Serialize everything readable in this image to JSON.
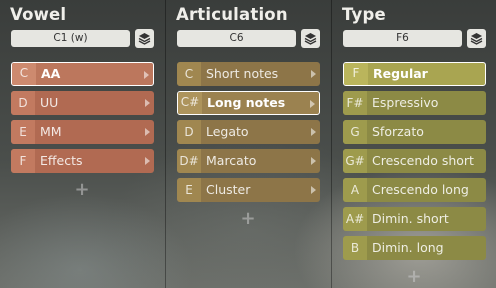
{
  "columns": [
    {
      "title": "Vowel",
      "selector": "C1 (w)",
      "theme": "red",
      "rows": [
        {
          "note": "C",
          "label": "AA",
          "active": true,
          "arrow": true
        },
        {
          "note": "D",
          "label": "UU",
          "active": false,
          "arrow": true
        },
        {
          "note": "E",
          "label": "MM",
          "active": false,
          "arrow": true
        },
        {
          "note": "F",
          "label": "Effects",
          "active": false,
          "arrow": true
        }
      ],
      "add_label": "+"
    },
    {
      "title": "Articulation",
      "selector": "C6",
      "theme": "tan",
      "rows": [
        {
          "note": "C",
          "label": "Short notes",
          "active": false,
          "arrow": true
        },
        {
          "note": "C#",
          "label": "Long notes",
          "active": true,
          "arrow": true
        },
        {
          "note": "D",
          "label": "Legato",
          "active": false,
          "arrow": true
        },
        {
          "note": "D#",
          "label": "Marcato",
          "active": false,
          "arrow": true
        },
        {
          "note": "E",
          "label": "Cluster",
          "active": false,
          "arrow": true
        }
      ],
      "add_label": "+"
    },
    {
      "title": "Type",
      "selector": "F6",
      "theme": "olive",
      "rows": [
        {
          "note": "F",
          "label": "Regular",
          "active": true,
          "arrow": false
        },
        {
          "note": "F#",
          "label": "Espressivo",
          "active": false,
          "arrow": false
        },
        {
          "note": "G",
          "label": "Sforzato",
          "active": false,
          "arrow": false
        },
        {
          "note": "G#",
          "label": "Crescendo short",
          "active": false,
          "arrow": false
        },
        {
          "note": "A",
          "label": "Crescendo long",
          "active": false,
          "arrow": false
        },
        {
          "note": "A#",
          "label": "Dimin. short",
          "active": false,
          "arrow": false
        },
        {
          "note": "B",
          "label": "Dimin. long",
          "active": false,
          "arrow": false
        }
      ],
      "add_label": "+"
    }
  ],
  "icons": {
    "selector_side": "layers-icon",
    "row_arrow": "chevron-right-icon",
    "add": "plus-icon"
  }
}
